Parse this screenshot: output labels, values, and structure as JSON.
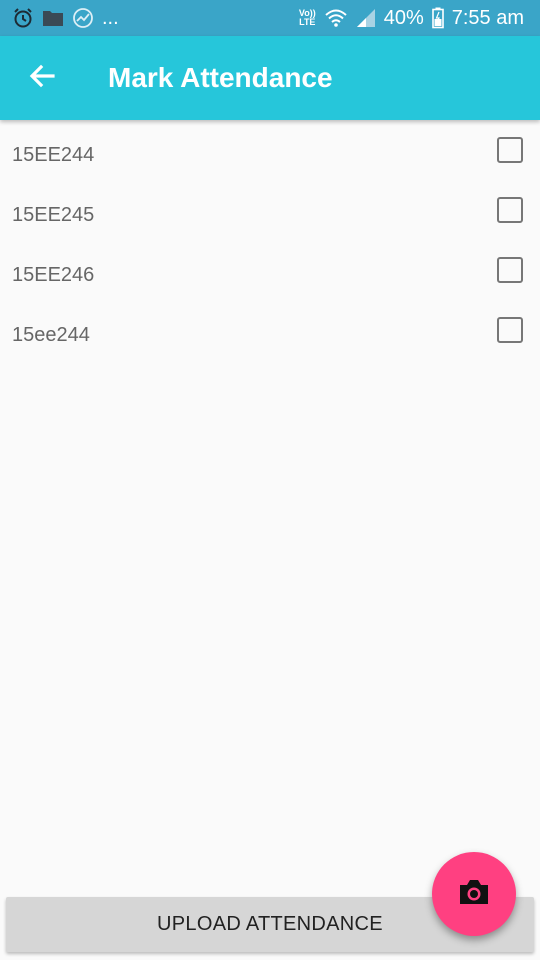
{
  "status_bar": {
    "more_indicator": "...",
    "volte_top": "Vo))",
    "volte_bottom": "LTE",
    "battery": "40%",
    "time": "7:55 am",
    "icons": [
      "alarm-icon",
      "folder-icon",
      "trend-icon",
      "wifi-icon",
      "signal-icon",
      "battery-icon"
    ]
  },
  "app_bar": {
    "title": "Mark Attendance",
    "back_icon": "arrow-left-icon",
    "color": "#26c6da"
  },
  "students": [
    {
      "id": "15EE244",
      "checked": false
    },
    {
      "id": "15EE245",
      "checked": false
    },
    {
      "id": "15EE246",
      "checked": false
    },
    {
      "id": "15ee244",
      "checked": false
    }
  ],
  "upload_button": {
    "label": "UPLOAD ATTENDANCE"
  },
  "fab": {
    "icon": "camera-icon",
    "color": "#ff4081"
  }
}
